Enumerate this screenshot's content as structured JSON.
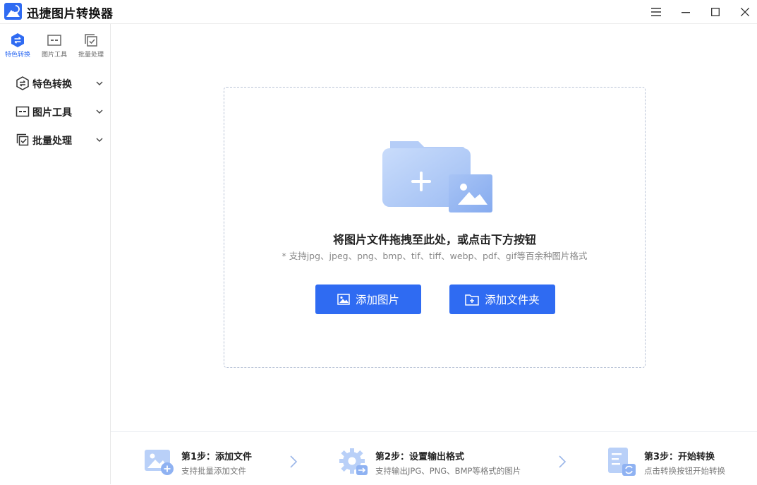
{
  "app": {
    "title": "迅捷图片转换器"
  },
  "sidebar": {
    "tabs": [
      {
        "label": "特色转换",
        "icon": "exchange-hexagon-icon",
        "active": true
      },
      {
        "label": "图片工具",
        "icon": "image-tool-icon",
        "active": false
      },
      {
        "label": "批量处理",
        "icon": "batch-check-icon",
        "active": false
      }
    ],
    "menu": [
      {
        "label": "特色转换",
        "icon": "exchange-hexagon-icon"
      },
      {
        "label": "图片工具",
        "icon": "image-tool-icon"
      },
      {
        "label": "批量处理",
        "icon": "batch-check-icon"
      }
    ]
  },
  "dropzone": {
    "title": "将图片文件拖拽至此处，或点击下方按钮",
    "hint": "* 支持jpg、jpeg、png、bmp、tif、tiff、webp、pdf、gif等百余种图片格式",
    "add_image_label": "添加图片",
    "add_folder_label": "添加文件夹"
  },
  "steps": [
    {
      "title": "第1步：添加文件",
      "desc": "支持批量添加文件",
      "icon": "add-image-step-icon"
    },
    {
      "title": "第2步：设置输出格式",
      "desc": "支持输出JPG、PNG、BMP等格式的图片",
      "icon": "gear-step-icon"
    },
    {
      "title": "第3步：开始转换",
      "desc": "点击转换按钮开始转换",
      "icon": "convert-document-step-icon"
    }
  ],
  "colors": {
    "accent": "#2f6bf2",
    "illustration": "#a9c6f7"
  }
}
